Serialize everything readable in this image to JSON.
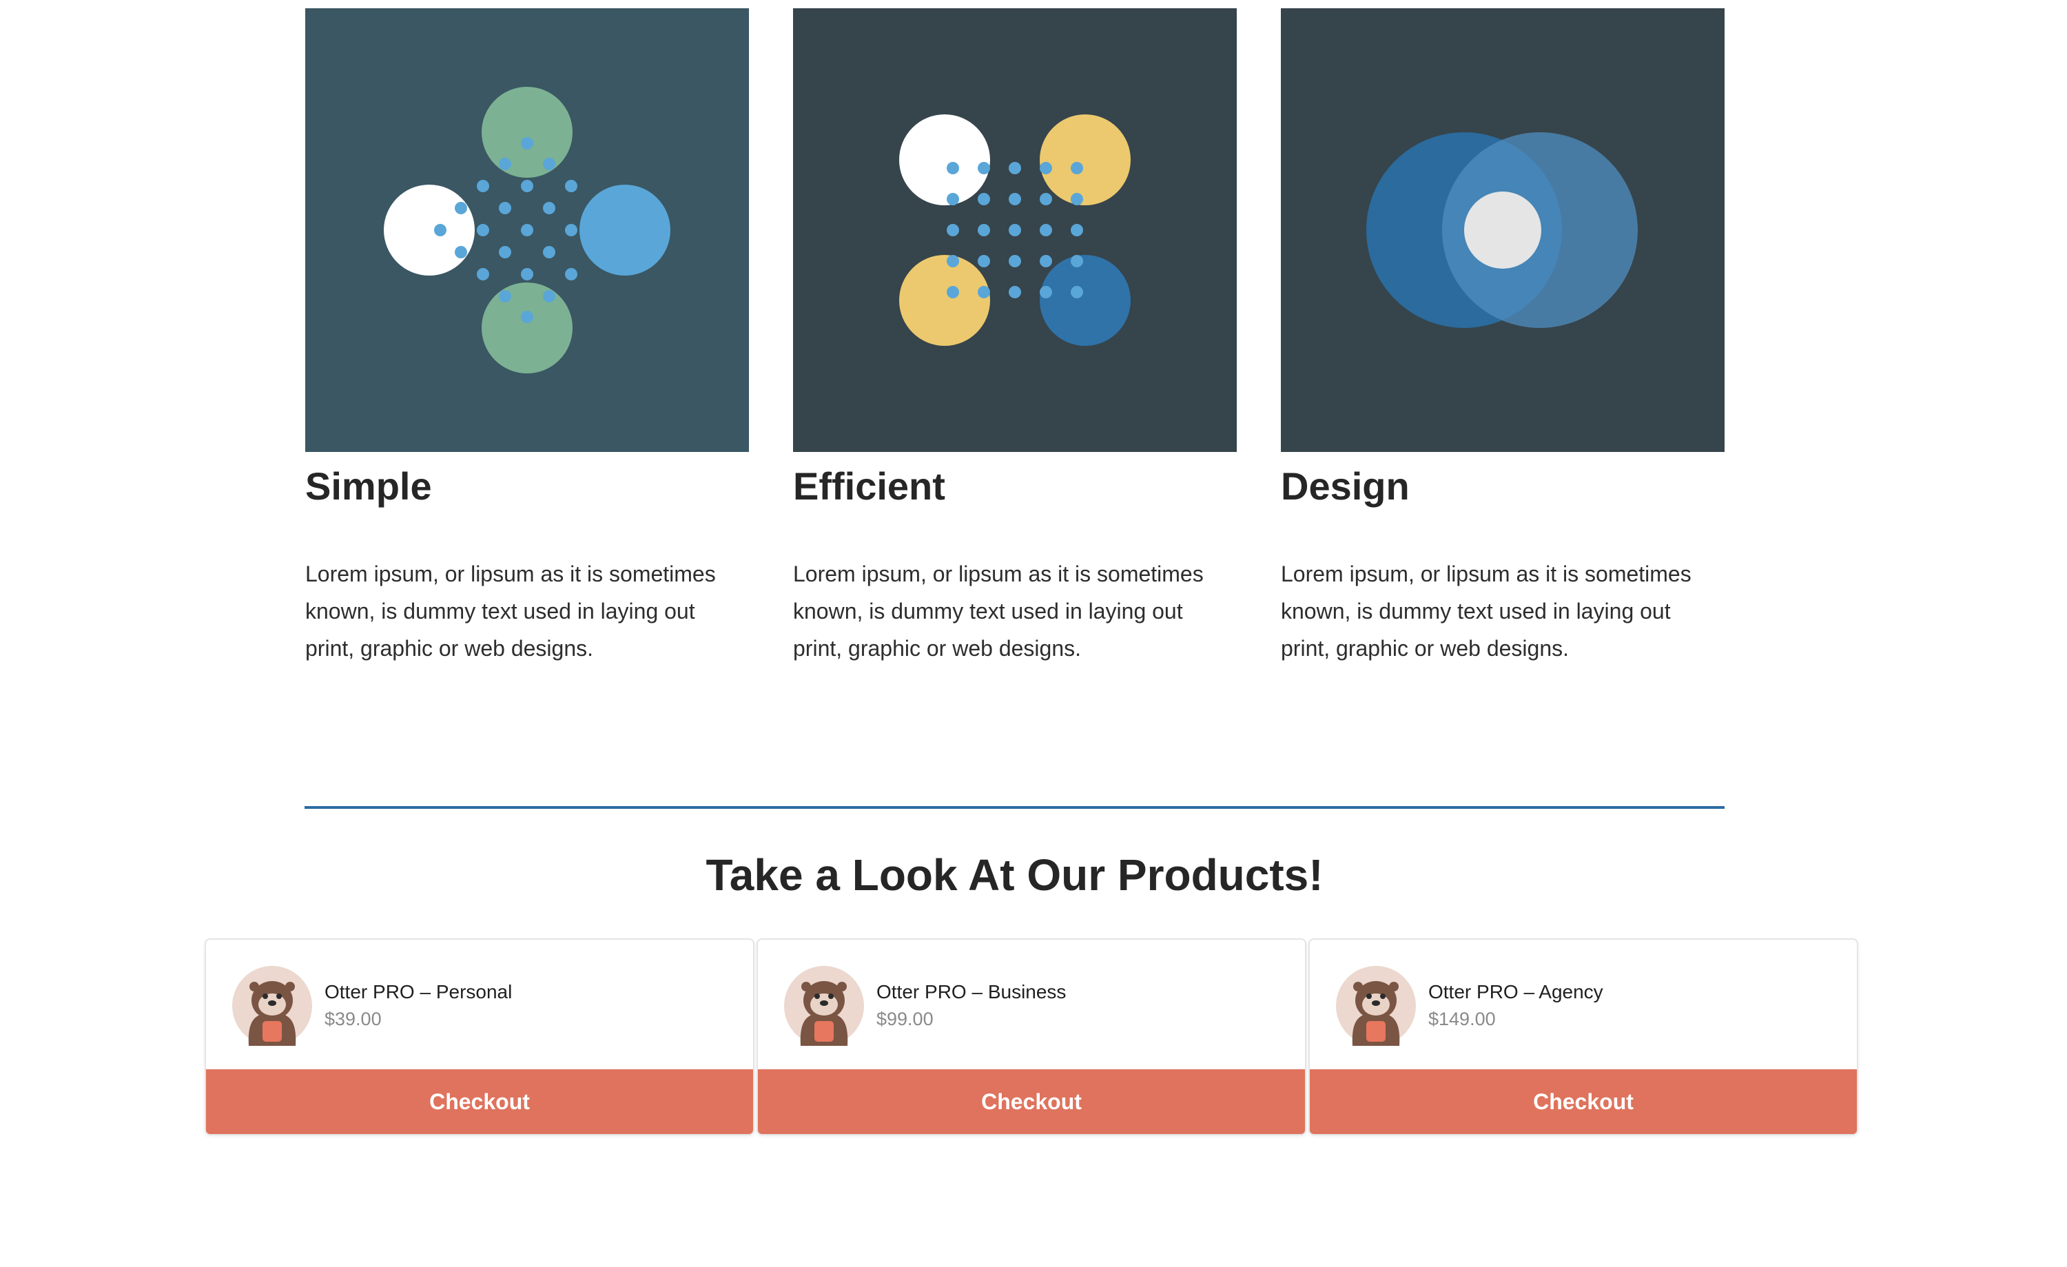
{
  "features": [
    {
      "title": "Simple",
      "text": "Lorem ipsum, or lipsum as it is sometimes known, is dummy text used in laying out print, graphic or web designs."
    },
    {
      "title": "Efficient",
      "text": "Lorem ipsum, or lipsum as it is sometimes known, is dummy text used in laying out print, graphic or web designs."
    },
    {
      "title": "Design",
      "text": "Lorem ipsum, or lipsum as it is sometimes known, is dummy text used in laying out print, graphic or web designs."
    }
  ],
  "products_section": {
    "title": "Take a Look At Our Products!",
    "items": [
      {
        "name": "Otter PRO – Personal",
        "price": "$39.00",
        "cta": "Checkout",
        "icon": "otter-avatar-icon"
      },
      {
        "name": "Otter PRO – Business",
        "price": "$99.00",
        "cta": "Checkout",
        "icon": "otter-avatar-icon"
      },
      {
        "name": "Otter PRO – Agency",
        "price": "$149.00",
        "cta": "Checkout",
        "icon": "otter-avatar-icon"
      }
    ]
  },
  "colors": {
    "tile_simple_bg": "#3a5763",
    "tile_dark_bg": "#36444b",
    "accent_blue": "#2d6ba3",
    "dot_blue": "#5aa6d8",
    "checkout_bg": "#df735d"
  }
}
